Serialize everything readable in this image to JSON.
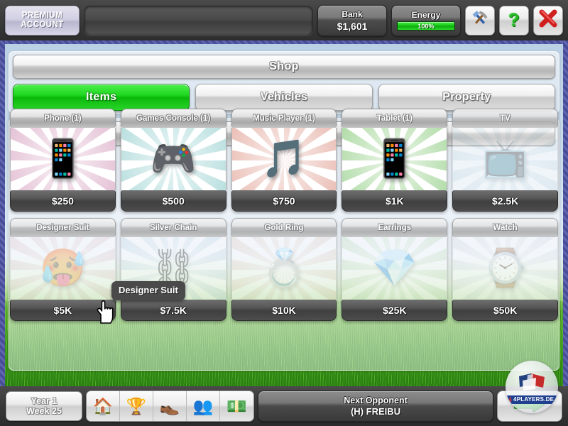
{
  "topbar": {
    "premium_label_line1": "PREMIUM",
    "premium_label_line2": "ACCOUNT",
    "name_field_value": "",
    "name_field_placeholder": "",
    "bank_label": "Bank",
    "bank_value": "$1,601",
    "energy_label": "Energy",
    "energy_value": "100%",
    "energy_percent": 100,
    "tools_icon": "tools-icon",
    "help_icon": "question-mark-icon",
    "close_icon": "close-x-icon"
  },
  "shop": {
    "title": "Shop",
    "tabs": [
      {
        "label": "Items",
        "active": true
      },
      {
        "label": "Vehicles",
        "active": false
      },
      {
        "label": "Property",
        "active": false
      }
    ],
    "section_title": "Items"
  },
  "items": [
    {
      "name": "Phone (1)",
      "price": "$250",
      "icon": "phone-icon",
      "glyph": "📱",
      "burst": "#cf8fb4",
      "owned": true
    },
    {
      "name": "Games Console (1)",
      "price": "$500",
      "icon": "games-console-icon",
      "glyph": "🎮",
      "burst": "#7fc4c4",
      "owned": true
    },
    {
      "name": "Music Player (1)",
      "price": "$750",
      "icon": "music-player-icon",
      "glyph": "🎵",
      "burst": "#d98a7a",
      "owned": true
    },
    {
      "name": "Tablet (1)",
      "price": "$1K",
      "icon": "tablet-icon",
      "glyph": "📱",
      "burst": "#72c061",
      "owned": true
    },
    {
      "name": "TV",
      "price": "$2.5K",
      "icon": "tv-icon",
      "glyph": "📺",
      "burst": "#8fb8c8",
      "owned": false
    },
    {
      "name": "Designer Suit",
      "price": "$5K",
      "icon": "designer-suit-icon",
      "glyph": "🥵",
      "burst": "#c98f8f",
      "owned": false
    },
    {
      "name": "Silver Chain",
      "price": "$7.5K",
      "icon": "silver-chain-icon",
      "glyph": "⛓",
      "burst": "#85aec4",
      "owned": false
    },
    {
      "name": "Gold Ring",
      "price": "$10K",
      "icon": "gold-ring-icon",
      "glyph": "💍",
      "burst": "#c99a7e",
      "owned": false
    },
    {
      "name": "Earrings",
      "price": "$25K",
      "icon": "earrings-icon",
      "glyph": "💎",
      "burst": "#84bb72",
      "owned": false
    },
    {
      "name": "Watch",
      "price": "$50K",
      "icon": "watch-icon",
      "glyph": "⌚",
      "burst": "#b5bcc4",
      "owned": false
    }
  ],
  "tooltip": {
    "text": "Designer Suit"
  },
  "bottombar": {
    "year_label": "Year 1",
    "week_label": "Week 25",
    "nav_icons": [
      {
        "name": "home-icon",
        "glyph": "🏠"
      },
      {
        "name": "trophy-icon",
        "glyph": "🏆"
      },
      {
        "name": "boot-icon",
        "glyph": "👞"
      },
      {
        "name": "staff-icon",
        "glyph": "👥"
      },
      {
        "name": "money-icon",
        "glyph": "💵"
      }
    ],
    "next_opponent_label": "Next Opponent",
    "next_opponent_value": "(H) FREIBU",
    "continue_icon": "green-arrow-icon"
  },
  "watermark": {
    "text": "4PLAYERS.DE"
  },
  "colors": {
    "accent_green": "#17c417",
    "frame_blue": "#4a4f9b",
    "grass_green": "#3f9e1c",
    "bar_dark": "#3a3a3a"
  }
}
